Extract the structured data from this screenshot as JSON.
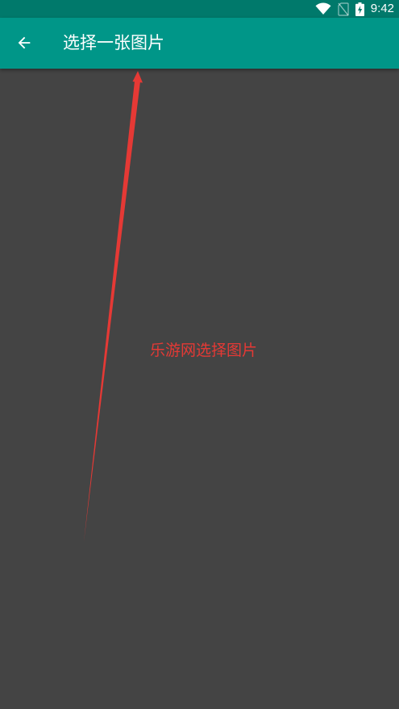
{
  "status_bar": {
    "time": "9:42",
    "icons": [
      "wifi-icon",
      "no-sim-icon",
      "battery-charging-icon"
    ]
  },
  "app_bar": {
    "back_icon": "arrow-back-icon",
    "title": "选择一张图片"
  },
  "annotation": {
    "text": "乐游网选择图片",
    "color": "#e53935"
  },
  "colors": {
    "status_bar": "#00796b",
    "app_bar": "#009688",
    "background": "#444444",
    "annotation": "#e53935"
  }
}
